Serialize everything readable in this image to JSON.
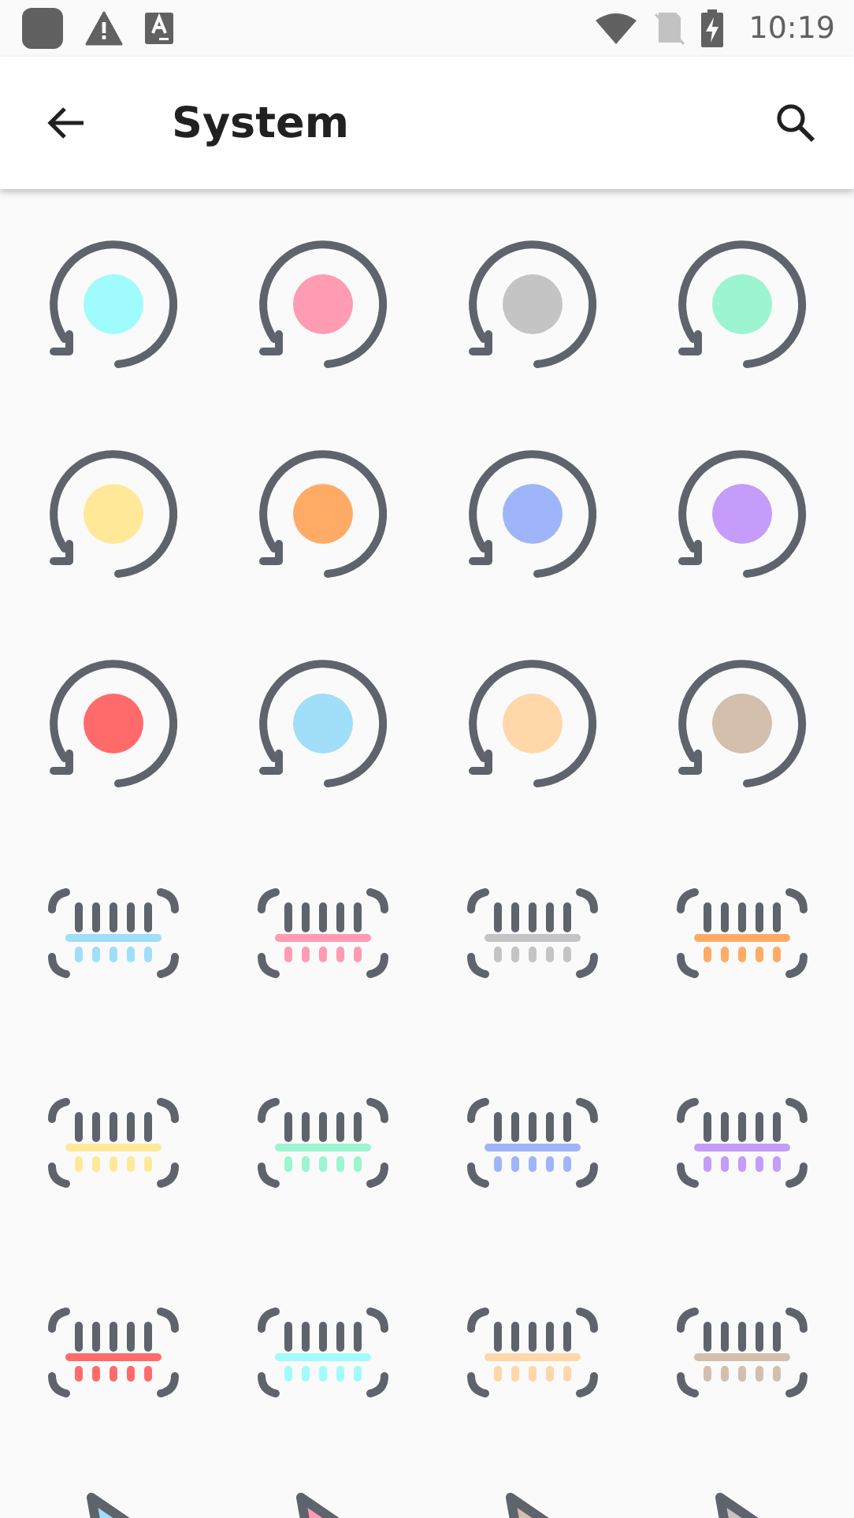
{
  "status_bar": {
    "time": "10:19"
  },
  "app_bar": {
    "title": "System"
  },
  "icons": [
    {
      "kind": "rotate",
      "color": "#a0fcfc"
    },
    {
      "kind": "rotate",
      "color": "#ff9bb3"
    },
    {
      "kind": "rotate",
      "color": "#c4c4c4"
    },
    {
      "kind": "rotate",
      "color": "#9cf5d0"
    },
    {
      "kind": "rotate",
      "color": "#ffe999"
    },
    {
      "kind": "rotate",
      "color": "#ffab66"
    },
    {
      "kind": "rotate",
      "color": "#9fb5fa"
    },
    {
      "kind": "rotate",
      "color": "#c59cf9"
    },
    {
      "kind": "rotate",
      "color": "#ff6b6b"
    },
    {
      "kind": "rotate",
      "color": "#a0def9"
    },
    {
      "kind": "rotate",
      "color": "#ffd7a8"
    },
    {
      "kind": "rotate",
      "color": "#d4beac"
    },
    {
      "kind": "barcode",
      "color": "#a0def9"
    },
    {
      "kind": "barcode",
      "color": "#ff9bb3"
    },
    {
      "kind": "barcode",
      "color": "#c4c4c4"
    },
    {
      "kind": "barcode",
      "color": "#ffab66"
    },
    {
      "kind": "barcode",
      "color": "#ffe999"
    },
    {
      "kind": "barcode",
      "color": "#9cf5d0"
    },
    {
      "kind": "barcode",
      "color": "#9fb5fa"
    },
    {
      "kind": "barcode",
      "color": "#c59cf9"
    },
    {
      "kind": "barcode",
      "color": "#ff6b6b"
    },
    {
      "kind": "barcode",
      "color": "#a0fcfc"
    },
    {
      "kind": "barcode",
      "color": "#ffd7a8"
    },
    {
      "kind": "barcode",
      "color": "#d4beac"
    },
    {
      "kind": "cursor",
      "color": "#a0def9"
    },
    {
      "kind": "cursor",
      "color": "#ff9bb3"
    },
    {
      "kind": "cursor",
      "color": "#d4beac"
    },
    {
      "kind": "cursor",
      "color": "#c4c4c4"
    }
  ]
}
